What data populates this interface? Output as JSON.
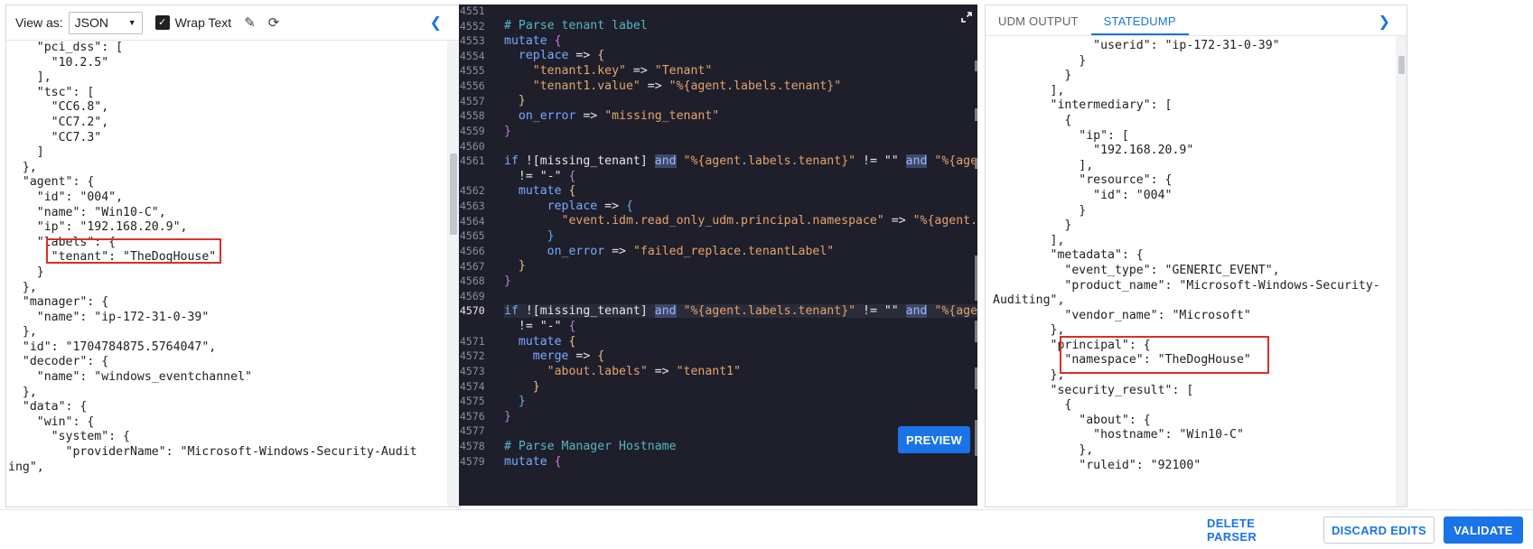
{
  "left_panel": {
    "view_as_label": "View as:",
    "view_as_value": "JSON",
    "wrap_text_label": "Wrap Text",
    "edit_icon": "pencil-icon",
    "refresh_icon": "refresh-icon",
    "collapse_icon": "chevron-left-icon",
    "lines": [
      "    \"pci_dss\": [",
      "      \"10.2.5\"",
      "    ],",
      "    \"tsc\": [",
      "      \"CC6.8\",",
      "      \"CC7.2\",",
      "      \"CC7.3\"",
      "    ]",
      "  },",
      "  \"agent\": {",
      "    \"id\": \"004\",",
      "    \"name\": \"Win10-C\",",
      "    \"ip\": \"192.168.20.9\",",
      "    \"labels\": {",
      "      \"tenant\": \"TheDogHouse\"",
      "    }",
      "  },",
      "  \"manager\": {",
      "    \"name\": \"ip-172-31-0-39\"",
      "  },",
      "  \"id\": \"1704784875.5764047\",",
      "  \"decoder\": {",
      "    \"name\": \"windows_eventchannel\"",
      "  },",
      "  \"data\": {",
      "    \"win\": {",
      "      \"system\": {",
      "        \"providerName\": \"Microsoft-Windows-Security-Audit",
      "ing\","
    ]
  },
  "editor": {
    "line_numbers": [
      "4551",
      "4552",
      "4553",
      "4554",
      "4555",
      "4556",
      "4557",
      "4558",
      "4559",
      "4560",
      "4561",
      "",
      "4562",
      "4563",
      "4564",
      "4565",
      "4566",
      "4567",
      "4568",
      "4569",
      "4570",
      "",
      "4571",
      "4572",
      "4573",
      "4574",
      "4575",
      "4576",
      "4577",
      "4578",
      "4579"
    ],
    "active_line": "4570",
    "code": {
      "l4552": "# Parse tenant label",
      "l4553_kw": "mutate",
      "l4554_kw": "replace",
      "l4554_op": " => ",
      "l4555_k": "\"tenant1.key\"",
      "l4555_v": "\"Tenant\"",
      "l4556_k": "\"tenant1.value\"",
      "l4556_v": "\"%{agent.labels.tenant}\"",
      "l4558_kw": "on_error",
      "l4558_v": "\"missing_tenant\"",
      "if_kw": "if",
      "not_missing": " ![missing_tenant] ",
      "and_kw": "and",
      "tenant_ref": " \"%{agent.labels.tenant}\" ",
      "neq_empty": "!= \"\" ",
      "tenant_ref_cut": " \"%{agent.labels.ten",
      "neq_dash": "!= \"-\"",
      "l4564_k": "\"event.idm.read_only_udm.principal.namespace\"",
      "l4564_v": "\"%{agent.labels.tena",
      "l4566_v": "\"failed_replace.tenantLabel\"",
      "merge_kw": "merge",
      "l4573_k": "\"about.labels\"",
      "l4573_v": "\"tenant1\"",
      "l4578": "# Parse Manager Hostname",
      "l4579_kw": "mutate"
    },
    "expand_icon": "expand-icon",
    "preview_label": "PREVIEW"
  },
  "right_panel": {
    "tabs": [
      "UDM OUTPUT",
      "STATEDUMP"
    ],
    "active_tab": "STATEDUMP",
    "expand_icon": "chevron-right-icon",
    "lines": [
      "              \"userid\": \"ip-172-31-0-39\"",
      "            }",
      "          }",
      "        ],",
      "        \"intermediary\": [",
      "          {",
      "            \"ip\": [",
      "              \"192.168.20.9\"",
      "            ],",
      "            \"resource\": {",
      "              \"id\": \"004\"",
      "            }",
      "          }",
      "        ],",
      "        \"metadata\": {",
      "          \"event_type\": \"GENERIC_EVENT\",",
      "          \"product_name\": \"Microsoft-Windows-Security-",
      "Auditing\",",
      "          \"vendor_name\": \"Microsoft\"",
      "        },",
      "        \"principal\": {",
      "          \"namespace\": \"TheDogHouse\"",
      "        },",
      "        \"security_result\": [",
      "          {",
      "            \"about\": {",
      "              \"hostname\": \"Win10-C\"",
      "            },",
      "            \"ruleid\": \"92100\""
    ]
  },
  "footer": {
    "delete_label": "DELETE PARSER",
    "discard_label": "DISCARD EDITS",
    "validate_label": "VALIDATE"
  },
  "colors": {
    "accent": "#1a73e8",
    "highlight_box": "#d93025",
    "editor_bg": "#1e1f2b"
  }
}
